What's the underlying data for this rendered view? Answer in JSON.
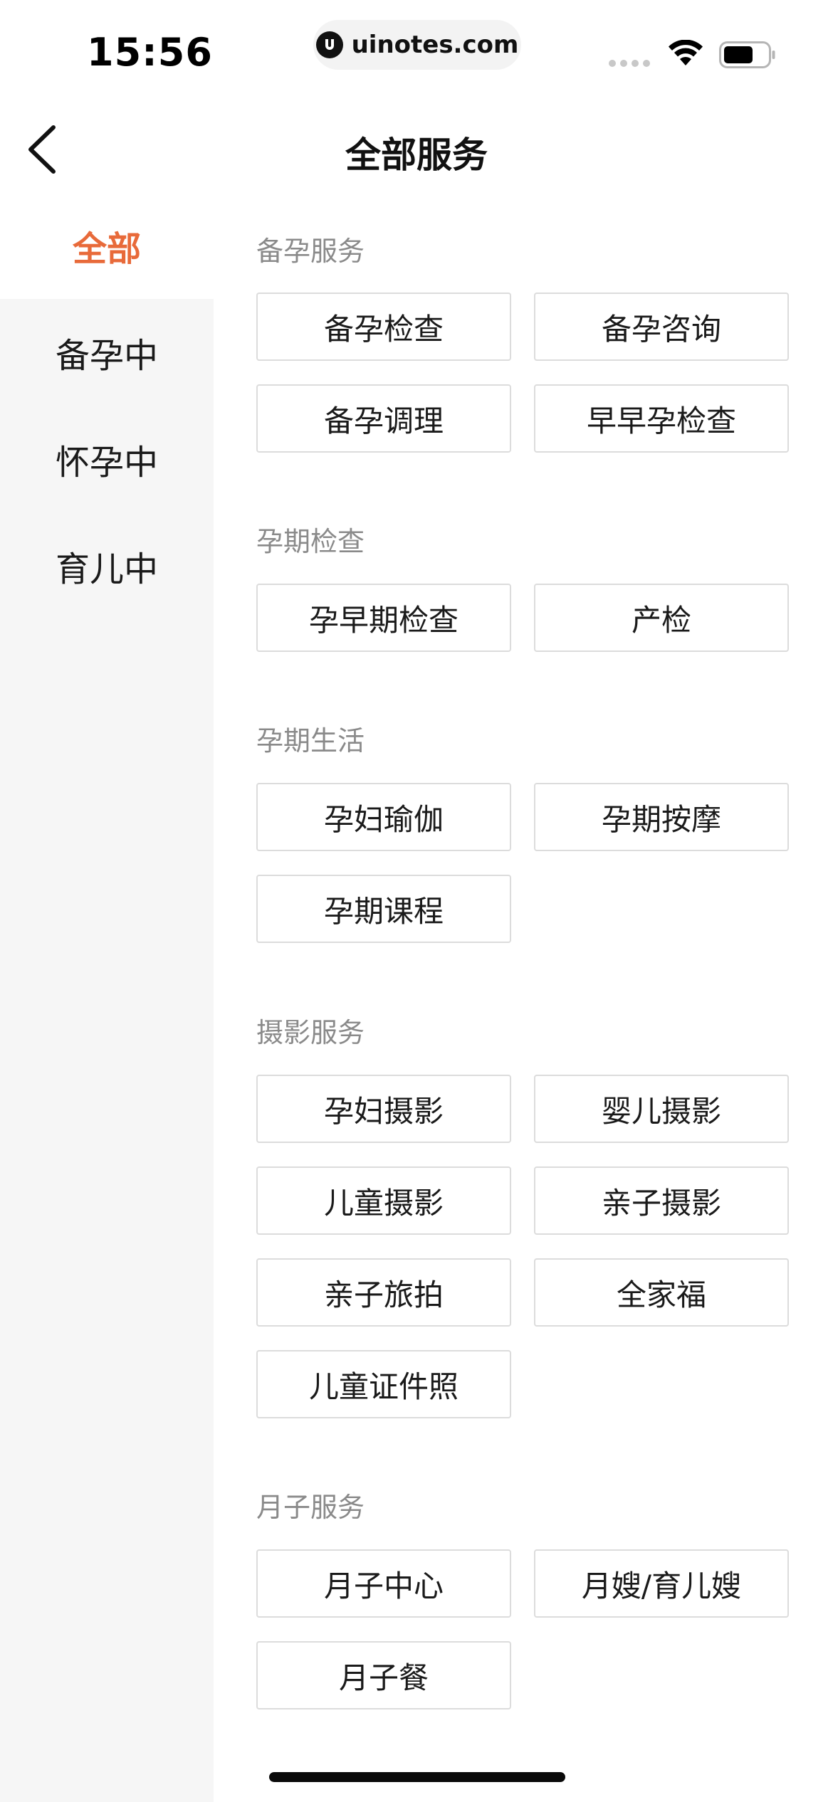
{
  "status_bar": {
    "time": "15:56",
    "url": "uinotes.com"
  },
  "nav": {
    "title": "全部服务"
  },
  "sidebar": {
    "items": [
      {
        "label": "全部",
        "active": true
      },
      {
        "label": "备孕中",
        "active": false
      },
      {
        "label": "怀孕中",
        "active": false
      },
      {
        "label": "育儿中",
        "active": false
      }
    ]
  },
  "sections": [
    {
      "title": "备孕服务",
      "items": [
        "备孕检查",
        "备孕咨询",
        "备孕调理",
        "早早孕检查"
      ]
    },
    {
      "title": "孕期检查",
      "items": [
        "孕早期检查",
        "产检"
      ]
    },
    {
      "title": "孕期生活",
      "items": [
        "孕妇瑜伽",
        "孕期按摩",
        "孕期课程"
      ]
    },
    {
      "title": "摄影服务",
      "items": [
        "孕妇摄影",
        "婴儿摄影",
        "儿童摄影",
        "亲子摄影",
        "亲子旅拍",
        "全家福",
        "儿童证件照"
      ]
    },
    {
      "title": "月子服务",
      "items": [
        "月子中心",
        "月嫂/育儿嫂",
        "月子餐"
      ]
    }
  ],
  "colors": {
    "accent": "#e86a3a",
    "sidebar_bg": "#f6f6f6",
    "section_title": "#8a8a8a",
    "button_border": "#dcdcdc"
  }
}
